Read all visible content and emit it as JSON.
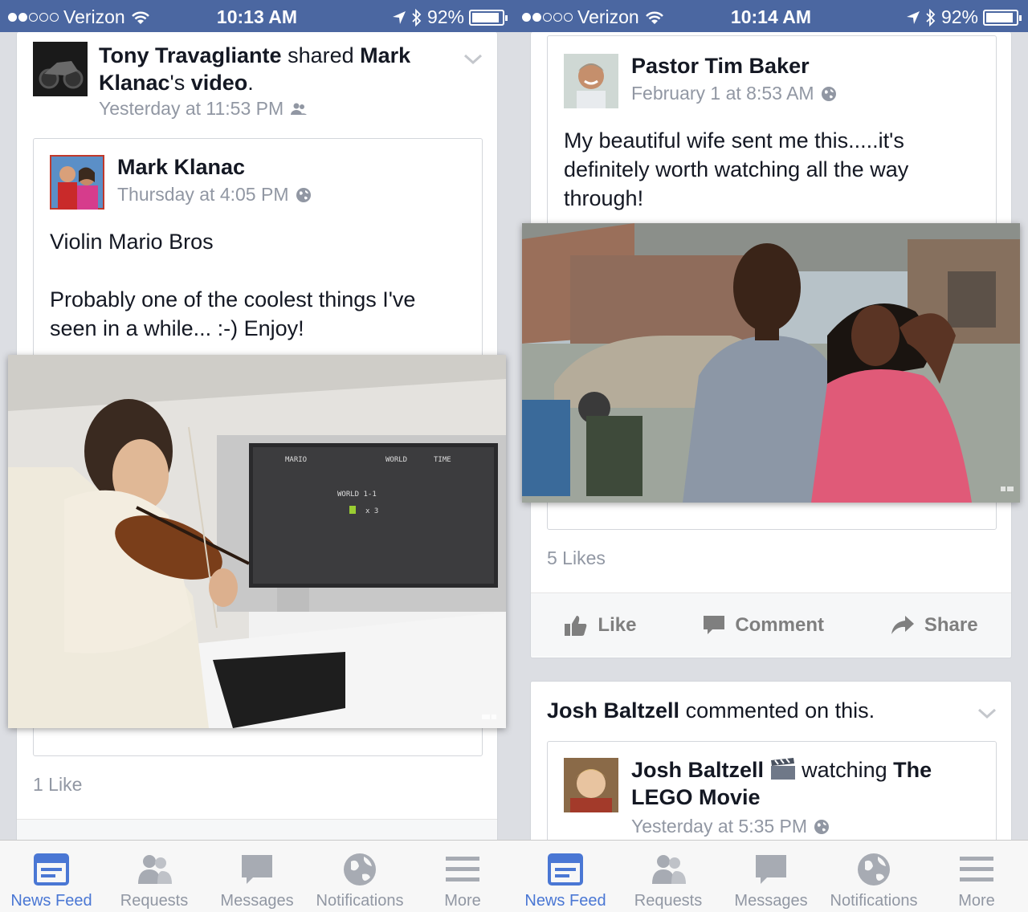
{
  "colors": {
    "brand": "#4b67a1",
    "active_tab": "#4a77d4",
    "muted": "#9197a3"
  },
  "left": {
    "status": {
      "carrier": "Verizon",
      "time": "10:13 AM",
      "battery": "92%",
      "battery_level": 0.92
    },
    "post": {
      "sharer": "Tony Travagliante",
      "shared_word": "shared",
      "owner_possessive": "Mark Klanac",
      "apostrophe": "'s",
      "object": "video",
      "period": ".",
      "timestamp": "Yesterday at 11:53 PM",
      "privacy_icon": "friends-icon",
      "inner": {
        "author": "Mark Klanac",
        "timestamp": "Thursday at 4:05 PM",
        "privacy_icon": "globe-icon",
        "title": "Violin Mario Bros",
        "body": "Probably one of the coolest things I've seen in a while... :-) Enjoy!"
      },
      "video_screen_text": {
        "world_label": "WORLD 1-1",
        "lives": "x 3"
      },
      "likes": "1 Like"
    }
  },
  "right": {
    "status": {
      "carrier": "Verizon",
      "time": "10:14 AM",
      "battery": "92%",
      "battery_level": 0.92
    },
    "post1": {
      "author": "Pastor Tim Baker",
      "timestamp": "February 1 at 8:53 AM",
      "privacy_icon": "globe-icon",
      "body": "My beautiful wife sent me this.....it's definitely worth watching all the way through!",
      "likes": "5 Likes",
      "actions": {
        "like": "Like",
        "comment": "Comment",
        "share": "Share"
      }
    },
    "post2": {
      "header_name": "Josh Baltzell",
      "header_action": "commented on this.",
      "inner": {
        "author": "Josh Baltzell",
        "activity": "watching",
        "movie": "The LEGO Movie",
        "timestamp": "Yesterday at 5:35 PM",
        "privacy_icon": "globe-icon"
      }
    }
  },
  "tabs": [
    {
      "label": "News Feed",
      "icon": "news-feed-icon",
      "active": true
    },
    {
      "label": "Requests",
      "icon": "requests-icon",
      "active": false
    },
    {
      "label": "Messages",
      "icon": "messages-icon",
      "active": false
    },
    {
      "label": "Notifications",
      "icon": "notifications-icon",
      "active": false
    },
    {
      "label": "More",
      "icon": "more-icon",
      "active": false
    }
  ]
}
